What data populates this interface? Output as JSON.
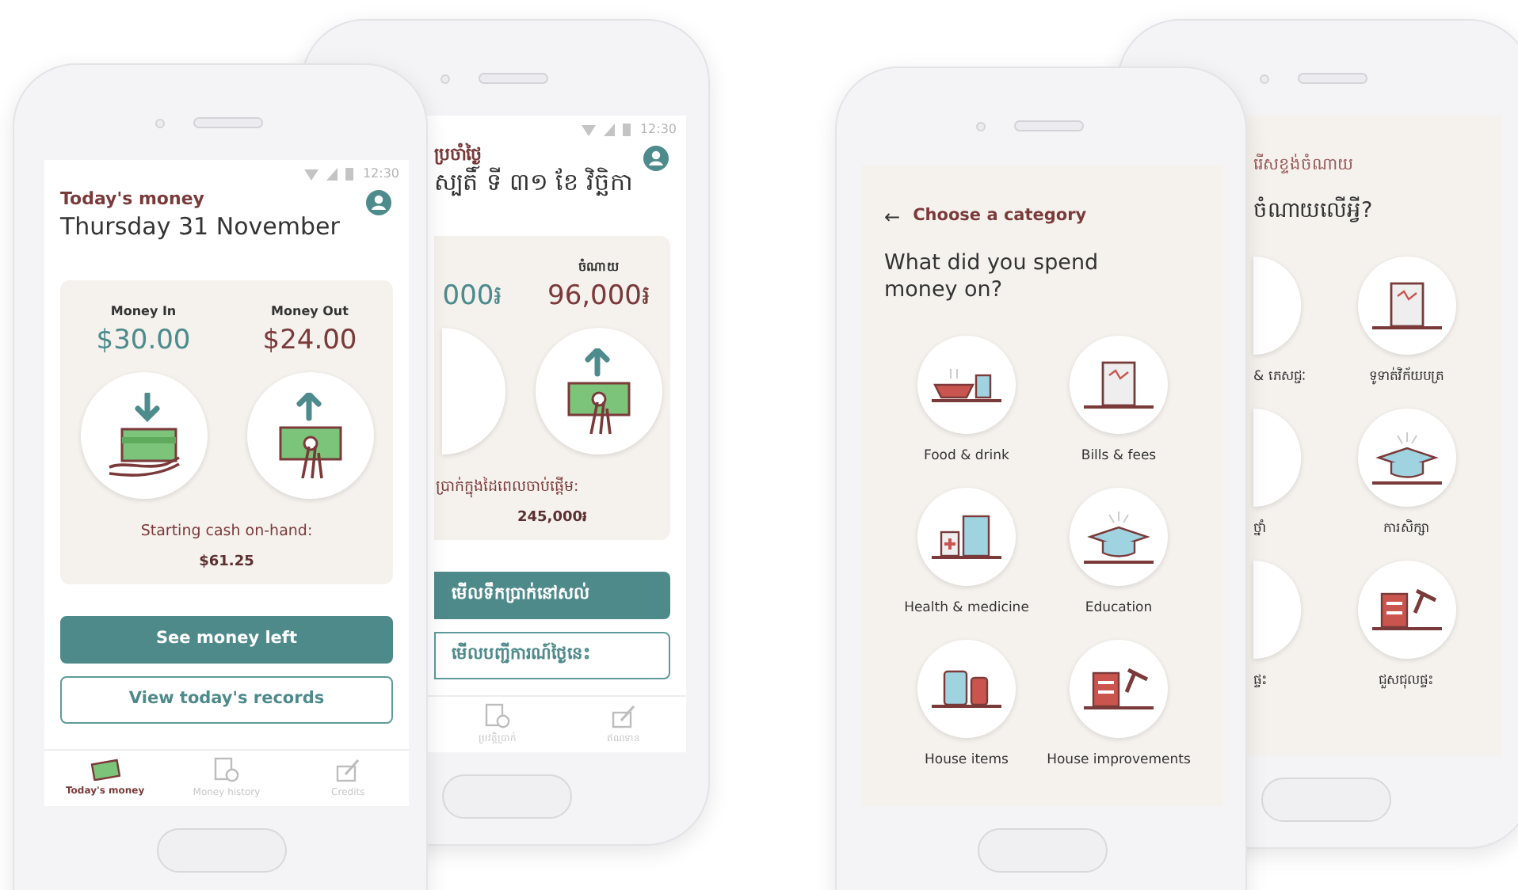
{
  "phones": [
    {
      "kind": "today",
      "status_time": "12:30",
      "section_title": "ប្រចាំថ្ងៃ",
      "date": "ស្បតិ៍ ទី ៣១ ខែ វិច្ឆិកា",
      "money_in": {
        "amount": "000៛"
      },
      "money_out": {
        "label": "ចំណាយ",
        "amount": "96,000៛"
      },
      "starting_label": "ប្រាក់ក្នុងដៃពេលចាប់ផ្តើម:",
      "starting_amount": "245,000៛",
      "buttons": [
        {
          "label": "មើលទឹកប្រាក់នៅសល់",
          "kind": "primary"
        },
        {
          "label": "មើលបញ្ជីការណ៍ថ្ងៃនេះ",
          "kind": "outline"
        }
      ],
      "nav": [
        {
          "label": "ប្រវត្តិប្រាក់",
          "selected": false
        },
        {
          "label": "ឥណទាន",
          "selected": false
        }
      ]
    },
    {
      "kind": "today",
      "status_time": "12:30",
      "section_title": "Today's money",
      "date": "Thursday 31 November",
      "money_in": {
        "label": "Money In",
        "amount": "$30.00"
      },
      "money_out": {
        "label": "Money Out",
        "amount": "$24.00"
      },
      "starting_label": "Starting cash on-hand:",
      "starting_amount": "$61.25",
      "buttons": [
        {
          "label": "See money left",
          "kind": "primary"
        },
        {
          "label": "View today's records",
          "kind": "outline"
        }
      ],
      "nav": [
        {
          "label": "Today's money",
          "selected": true
        },
        {
          "label": "Money history",
          "selected": false
        },
        {
          "label": "Credits",
          "selected": false
        }
      ]
    },
    {
      "kind": "category",
      "heading": "រើសខ្ទង់ចំណាយ",
      "question": "ចំណាយលើអ្វី?",
      "categories": [
        {
          "label": "& ភេសជ្ជៈ"
        },
        {
          "label": "ទូទាត់វិក័យបត្រ"
        },
        {
          "label": "ថ្នាំ"
        },
        {
          "label": "ការសិក្សា"
        },
        {
          "label": "ផ្ទះ"
        },
        {
          "label": "ជួសជុលផ្ទះ"
        }
      ]
    },
    {
      "kind": "category",
      "back_arrow": "←",
      "heading": "Choose a category",
      "question": "What did you spend money on?",
      "categories": [
        {
          "label": "Food & drink"
        },
        {
          "label": "Bills & fees"
        },
        {
          "label": "Health & medicine"
        },
        {
          "label": "Education"
        },
        {
          "label": "House items"
        },
        {
          "label": "House improvements"
        }
      ]
    }
  ]
}
